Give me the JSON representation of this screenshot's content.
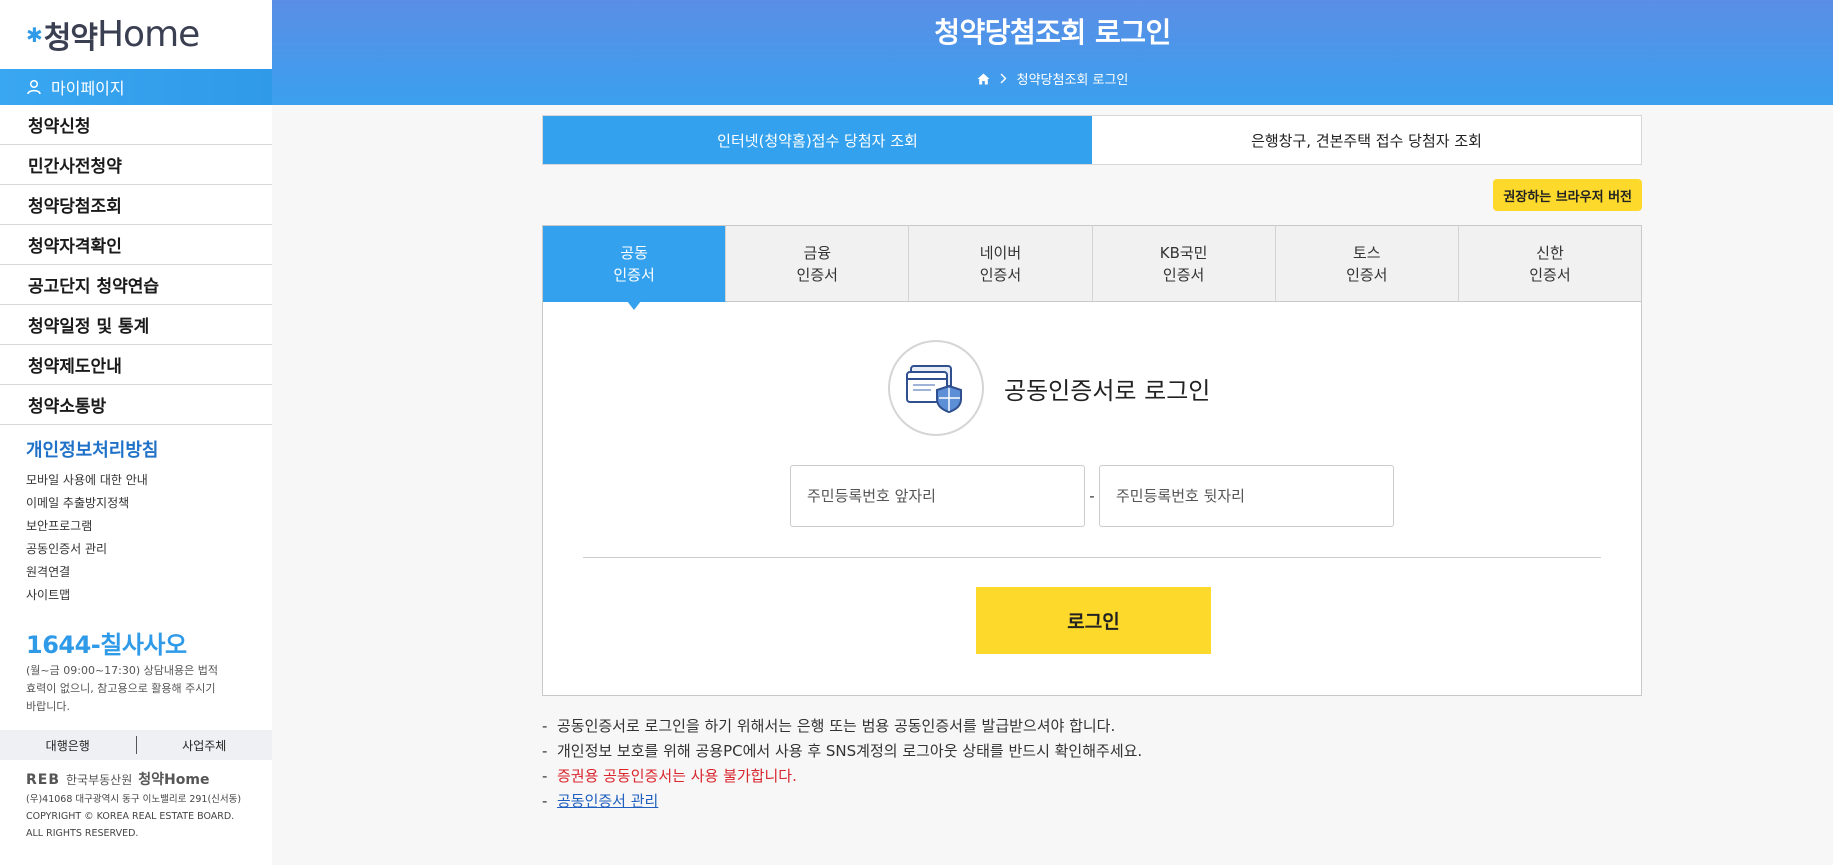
{
  "sidebar": {
    "logo_ko": "청약",
    "logo_en": "Home",
    "mypage": "마이페이지",
    "menu": [
      {
        "label": "청약신청"
      },
      {
        "label": "민간사전청약"
      },
      {
        "label": "청약당첨조회"
      },
      {
        "label": "청약자격확인"
      },
      {
        "label": "공고단지 청약연습"
      },
      {
        "label": "청약일정 및 통계"
      },
      {
        "label": "청약제도안내"
      },
      {
        "label": "청약소통방"
      }
    ],
    "policy_title": "개인정보처리방침",
    "policy_links": [
      {
        "label": "모바일 사용에 대한 안내"
      },
      {
        "label": "이메일 추출방지정책"
      },
      {
        "label": "보안프로그램"
      },
      {
        "label": "공동인증서 관리"
      },
      {
        "label": "원격연결"
      },
      {
        "label": "사이트맵"
      }
    ],
    "call_number": "1644-칠사사오",
    "call_note": "(월~금 09:00~17:30) 상담내용은 법적효력이 없으니, 참고용으로 활용해 주시기 바랍니다.",
    "link_bank": "대행은행",
    "link_biz": "사업주체",
    "footer_brand": "REB",
    "footer_org": "한국부동산원",
    "footer_site": "청약Home",
    "footer_address": "(우)41068 대구광역시 동구 이노밸리로 291(신서동)",
    "footer_copyright": "COPYRIGHT © KOREA REAL ESTATE BOARD.",
    "footer_rights": "ALL RIGHTS RESERVED."
  },
  "header": {
    "title": "청약당첨조회 로그인",
    "breadcrumb": "청약당첨조회 로그인"
  },
  "main": {
    "top_tabs": [
      {
        "label": "인터넷(청약홈)접수 당첨자 조회",
        "active": true
      },
      {
        "label": "은행창구, 견본주택 접수 당첨자 조회",
        "active": false
      }
    ],
    "browser_button": "권장하는 브라우저 버전",
    "cert_tabs": [
      {
        "line1": "공동",
        "line2": "인증서",
        "active": true
      },
      {
        "line1": "금융",
        "line2": "인증서",
        "active": false
      },
      {
        "line1": "네이버",
        "line2": "인증서",
        "active": false
      },
      {
        "line1": "KB국민",
        "line2": "인증서",
        "active": false
      },
      {
        "line1": "토스",
        "line2": "인증서",
        "active": false
      },
      {
        "line1": "신한",
        "line2": "인증서",
        "active": false
      }
    ],
    "login_title": "공동인증서로 로그인",
    "id_front_placeholder": "주민등록번호 앞자리",
    "id_back_placeholder": "주민등록번호 뒷자리",
    "id_separator": "-",
    "login_button": "로그인",
    "notes": [
      "공동인증서로 로그인을 하기 위해서는 은행 또는 범용 공동인증서를 발급받으셔야 합니다.",
      "개인정보 보호를 위해 공용PC에서 사용 후 SNS계정의 로그아웃 상태를 반드시 확인해주세요.",
      "증권용 공동인증서는 사용 불가합니다.",
      "공동인증서 관리"
    ],
    "note_bullet": "-"
  },
  "colors": {
    "accent_blue": "#33a1ee",
    "yellow": "#fcd92a",
    "warning_red": "#d9262e"
  }
}
